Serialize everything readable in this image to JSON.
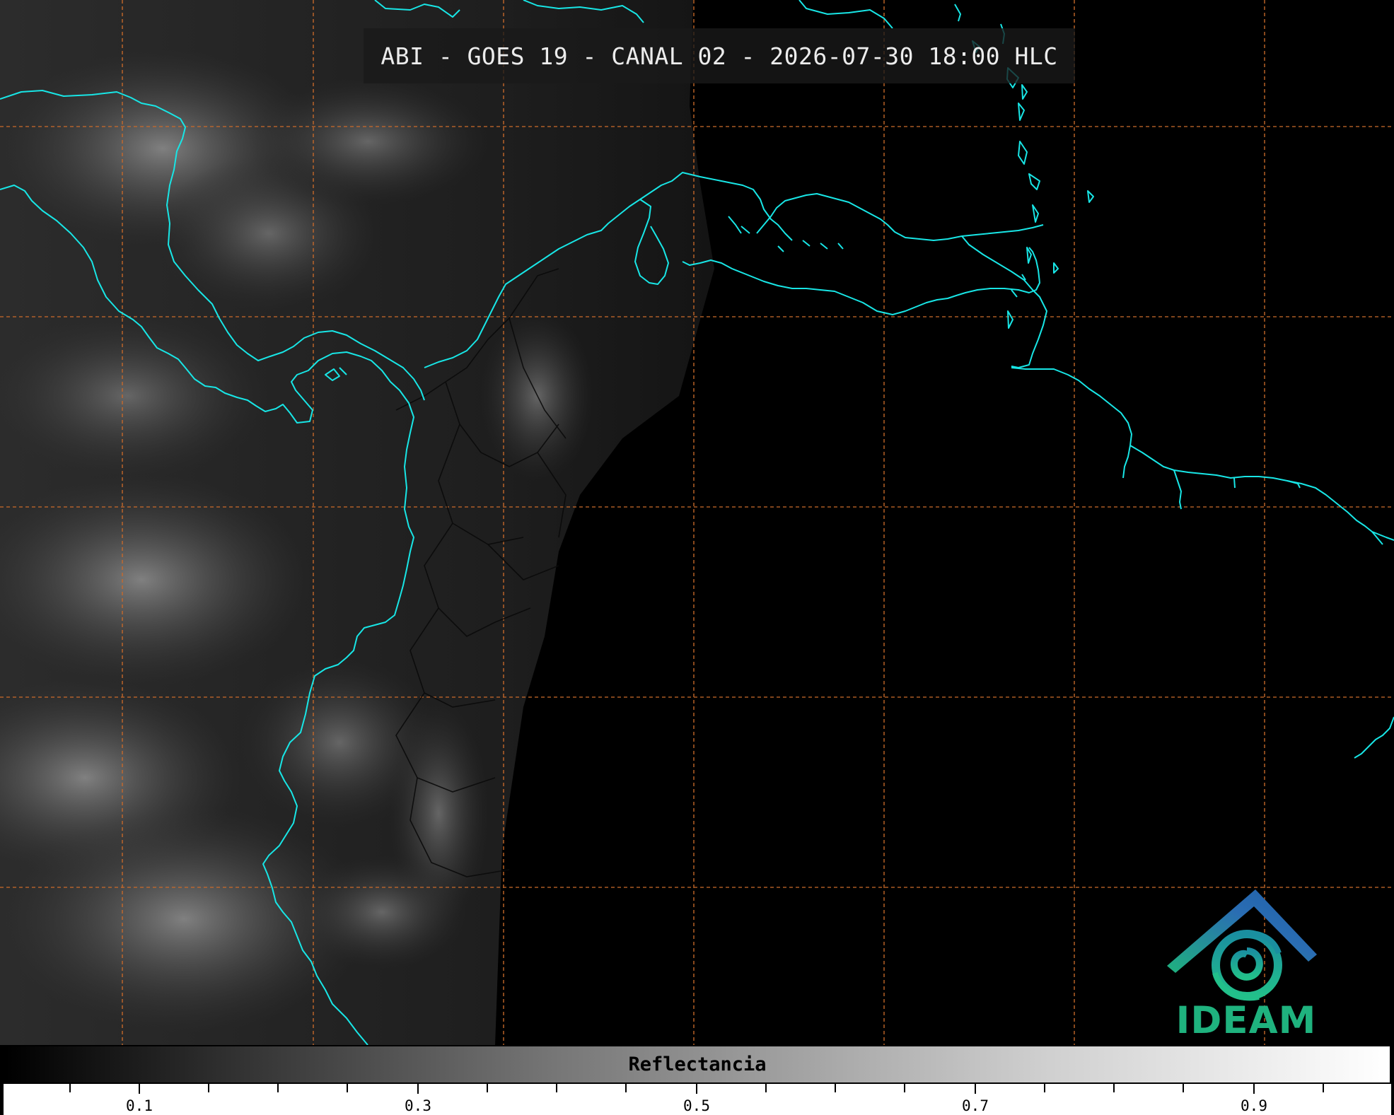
{
  "title": "ABI - GOES 19 - CANAL 02 - 2026-07-30 18:00 HLC",
  "logo": {
    "text": "IDEAM",
    "color": "#1fb27e",
    "roof_color": "#2a6db3"
  },
  "colors": {
    "coastline": "#18e6e6",
    "grid": "#c96a2a",
    "background": "#000000"
  },
  "colorbar": {
    "label": "Reflectancia",
    "range": [
      0.0,
      1.0
    ],
    "ticks": [
      "0.1",
      "0.3",
      "0.5",
      "0.7",
      "0.9"
    ]
  }
}
